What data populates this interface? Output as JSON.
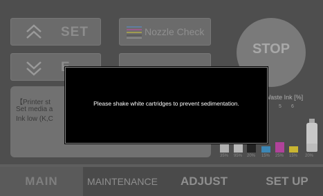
{
  "controls": {
    "set_label": "SET",
    "exit_label": "E",
    "nozzle_check_label": "Nozzle Check",
    "stop_label": "STOP"
  },
  "status": {
    "line1": "【Printer st",
    "line2": "Set media a",
    "line3": "Ink low (K,C"
  },
  "ink_panel": {
    "title": "/ Waste Ink [%]",
    "slot_numbers": [
      "5",
      "6"
    ],
    "levels": [
      {
        "percent_label": "35%",
        "level": 0.35,
        "color": "#b0b0b0"
      },
      {
        "percent_label": "95%",
        "level": 0.95,
        "color": "#b8b8b8"
      },
      {
        "percent_label": "20%",
        "level": 0.2,
        "color": "#222222"
      },
      {
        "percent_label": "15%",
        "level": 0.15,
        "color": "#3c86b5"
      },
      {
        "percent_label": "25%",
        "level": 0.25,
        "color": "#b0429a"
      },
      {
        "percent_label": "15%",
        "level": 0.15,
        "color": "#c9b531"
      },
      {
        "percent_label": "20%",
        "level": 0.2,
        "color": "#9a9a9a"
      }
    ]
  },
  "tabs": {
    "main": "MAIN",
    "maintenance": "MAINTENANCE",
    "adjust": "ADJUST",
    "setup": "SET UP"
  },
  "modal": {
    "message": "Please shake white cartridges to prevent sedimentation."
  }
}
